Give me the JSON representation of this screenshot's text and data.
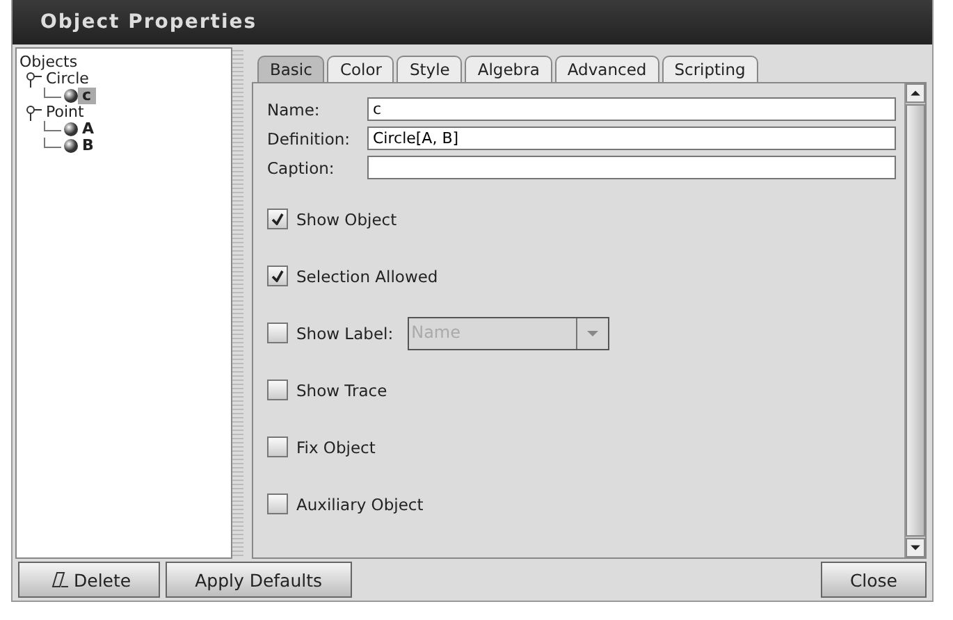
{
  "window": {
    "title": "Object Properties"
  },
  "tree": {
    "label": "Objects",
    "children": [
      {
        "label": "Circle",
        "expanded": true,
        "selected": false,
        "children": [
          {
            "label": "c",
            "selected": true
          }
        ]
      },
      {
        "label": "Point",
        "expanded": true,
        "selected": false,
        "children": [
          {
            "label": "A",
            "selected": false
          },
          {
            "label": "B",
            "selected": false
          }
        ]
      }
    ]
  },
  "tabs": [
    {
      "label": "Basic",
      "selected": true
    },
    {
      "label": "Color",
      "selected": false
    },
    {
      "label": "Style",
      "selected": false
    },
    {
      "label": "Algebra",
      "selected": false
    },
    {
      "label": "Advanced",
      "selected": false
    },
    {
      "label": "Scripting",
      "selected": false
    }
  ],
  "fields": [
    {
      "label": "Name:",
      "value": "c"
    },
    {
      "label": "Definition:",
      "value": "Circle[A, B]"
    },
    {
      "label": "Caption:"
    }
  ],
  "options": [
    {
      "kind": "checkbox",
      "label": "Show Object",
      "checked": true
    },
    {
      "kind": "checkbox",
      "label": "Selection Allowed",
      "checked": true
    },
    {
      "kind": "dropdown",
      "label": "Show Label:",
      "checked": false,
      "dropdown": {
        "value": "Name",
        "disabled": true
      }
    },
    {
      "kind": "checkbox",
      "label": "Show Trace",
      "checked": false
    },
    {
      "kind": "checkbox",
      "label": "Fix Object",
      "checked": false
    },
    {
      "kind": "checkbox",
      "label": "Auxiliary Object",
      "checked": false
    }
  ],
  "buttons": {
    "left": [
      "Delete",
      "Apply Defaults"
    ],
    "right": [
      "Close"
    ]
  }
}
